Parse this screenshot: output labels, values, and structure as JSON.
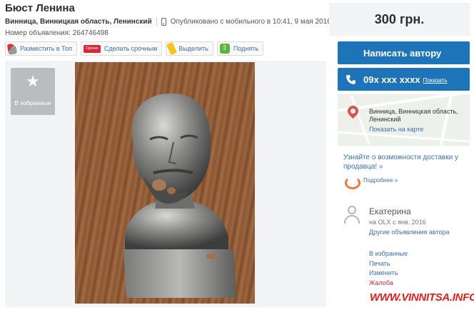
{
  "listing": {
    "title": "Бюст Ленина",
    "location": "Винница, Винницкая область, Ленинский",
    "published": "Опубликовано с мобильного в 10:41, 9 мая 2016,",
    "ad_id_label": "Номер объявления: 264746498"
  },
  "actions": [
    {
      "label": "Разместить в Топ",
      "icon": "rocket-icon"
    },
    {
      "label": "Сделать срочным",
      "icon": "urgent-badge-icon",
      "badge_text": "Срочно"
    },
    {
      "label": "Выделить",
      "icon": "marker-icon"
    },
    {
      "label": "Поднять",
      "icon": "arrow-up-icon"
    }
  ],
  "gallery": {
    "favorite_label": "В избранные",
    "favorite_icon": "star-icon"
  },
  "price": "300 грн.",
  "contact": {
    "message_button": "Написать автору",
    "phone_number": "09х ххх хххх",
    "show_phone": "Показать"
  },
  "map": {
    "address": [
      "Винница, Винницкая область,",
      "Ленинский"
    ],
    "show_on_map": "Показать на карте"
  },
  "delivery": {
    "text": "Узнайте о возможности доставки у продавца! »",
    "more": "Подробнее »"
  },
  "seller": {
    "name": "Екатерина",
    "since": "на OLX с янв. 2016",
    "other_ads": "Другие объявления автора"
  },
  "sidebar_links": {
    "favorite": "В избранные",
    "print": "Печать",
    "edit": "Изменить",
    "complaint": "Жалоба"
  },
  "watermark": "WWW.VINNITSA.INFO",
  "colors": {
    "accent": "#1e74b9",
    "link": "#3c6fb0",
    "warning": "#d9283a"
  }
}
